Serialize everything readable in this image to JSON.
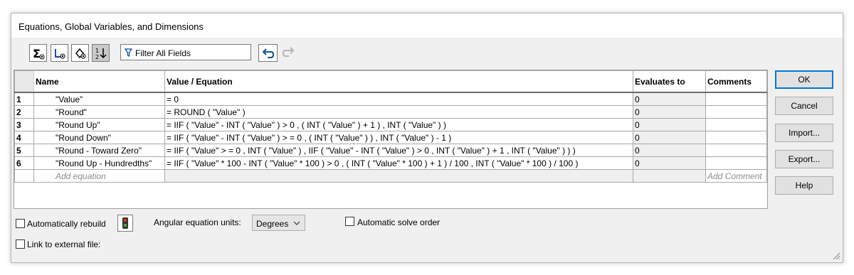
{
  "title": "Equations, Global Variables, and Dimensions",
  "toolbar": {
    "icons": [
      "equation-view-icon",
      "sketch-equation-view-icon",
      "dimension-view-icon",
      "ordered-view-icon",
      "undo-icon",
      "redo-icon"
    ],
    "filter_placeholder": "Filter All Fields"
  },
  "table": {
    "headers": {
      "name": "Name",
      "value": "Value / Equation",
      "evaluates": "Evaluates to",
      "comments": "Comments"
    },
    "rows": [
      {
        "num": "1",
        "name": "\"Value\"",
        "equation": "= 0",
        "evaluates": "0",
        "comment": ""
      },
      {
        "num": "2",
        "name": "\"Round\"",
        "equation": "= ROUND ( \"Value\" )",
        "evaluates": "0",
        "comment": ""
      },
      {
        "num": "3",
        "name": "\"Round Up\"",
        "equation": "= IIF ( \"Value\" - INT ( \"Value\" ) > 0 , ( INT ( \"Value\" ) + 1 ) , INT ( \"Value\" ) )",
        "evaluates": "0",
        "comment": ""
      },
      {
        "num": "4",
        "name": "\"Round Down\"",
        "equation": "= IIF ( \"Value\" - INT ( \"Value\" ) > = 0 , ( INT ( \"Value\" ) ) , INT ( \"Value\" ) - 1 )",
        "evaluates": "0",
        "comment": ""
      },
      {
        "num": "5",
        "name": "\"Round - Toward Zero\"",
        "equation": "= IIF ( \"Value\" > = 0 , INT ( \"Value\" ) , IIF ( \"Value\" - INT ( \"Value\" ) > 0 , INT ( \"Value\" ) + 1 , INT ( \"Value\" ) ) )",
        "evaluates": "0",
        "comment": ""
      },
      {
        "num": "6",
        "name": "\"Round Up - Hundredths\"",
        "equation": "= IIF ( \"Value\" * 100 - INT ( \"Value\" * 100 ) > 0 , ( INT ( \"Value\" * 100 ) + 1 ) / 100 , INT ( \"Value\" * 100 ) / 100 )",
        "evaluates": "0",
        "comment": ""
      }
    ],
    "add_equation_placeholder": "Add equation",
    "add_comment_placeholder": "Add Comment"
  },
  "buttons": {
    "ok": "OK",
    "cancel": "Cancel",
    "import": "Import...",
    "export": "Export...",
    "help": "Help"
  },
  "options": {
    "auto_rebuild": "Automatically rebuild",
    "angular_units_label": "Angular equation units:",
    "angular_units_value": "Degrees",
    "auto_solve": "Automatic solve order",
    "link_external": "Link to external file:"
  }
}
